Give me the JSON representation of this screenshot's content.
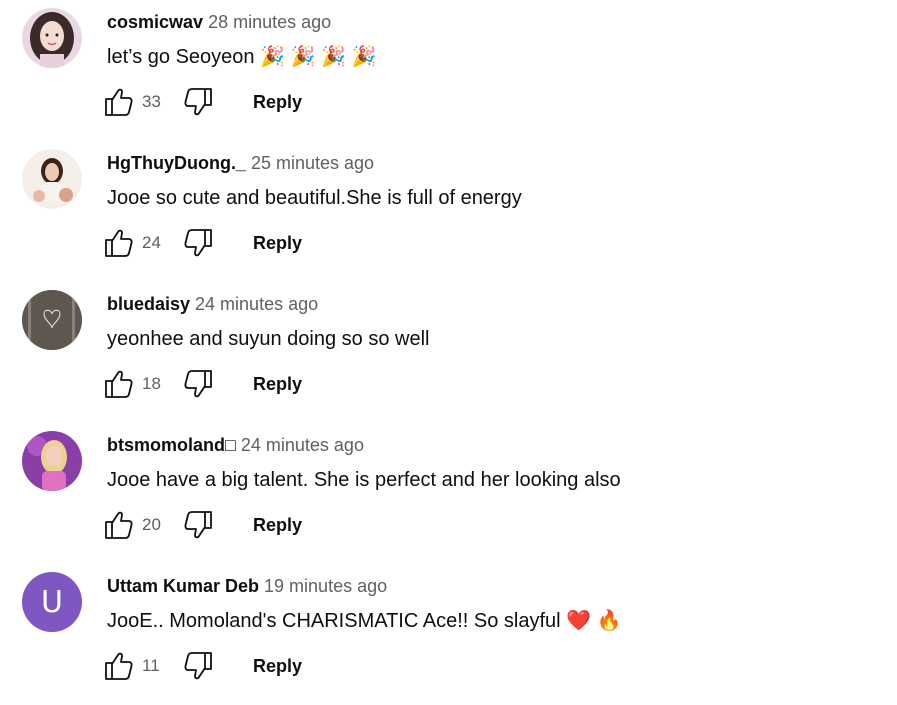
{
  "comments": [
    {
      "author": "cosmicwav",
      "time": "28 minutes ago",
      "text": "let’s go Seoyeon 🎉 🎉 🎉 🎉",
      "likes": "33",
      "reply_label": "Reply",
      "avatar": "photo-icon"
    },
    {
      "author": "HgThuyDuong._",
      "time": "25 minutes ago",
      "text": "Jooe so cute and beautiful.She is full of energy",
      "likes": "24",
      "reply_label": "Reply",
      "avatar": "photo-icon"
    },
    {
      "author": "bluedaisy",
      "time": "24 minutes ago",
      "text": "yeonhee and suyun doing so so well",
      "likes": "18",
      "reply_label": "Reply",
      "avatar": "photo-icon"
    },
    {
      "author": "btsmomoland□",
      "time": "24 minutes ago",
      "text": "Jooe have a big talent. She is perfect and her looking also",
      "likes": "20",
      "reply_label": "Reply",
      "avatar": "photo-icon"
    },
    {
      "author": "Uttam Kumar Deb",
      "time": "19 minutes ago",
      "text": "JooE.. Momoland's CHARISMATIC Ace!! So slayful ❤️ 🔥",
      "likes": "11",
      "reply_label": "Reply",
      "avatar_letter": "U",
      "avatar_color": "#7e57c2"
    }
  ],
  "icons": {
    "like": "thumbs-up-icon",
    "dislike": "thumbs-down-icon"
  }
}
